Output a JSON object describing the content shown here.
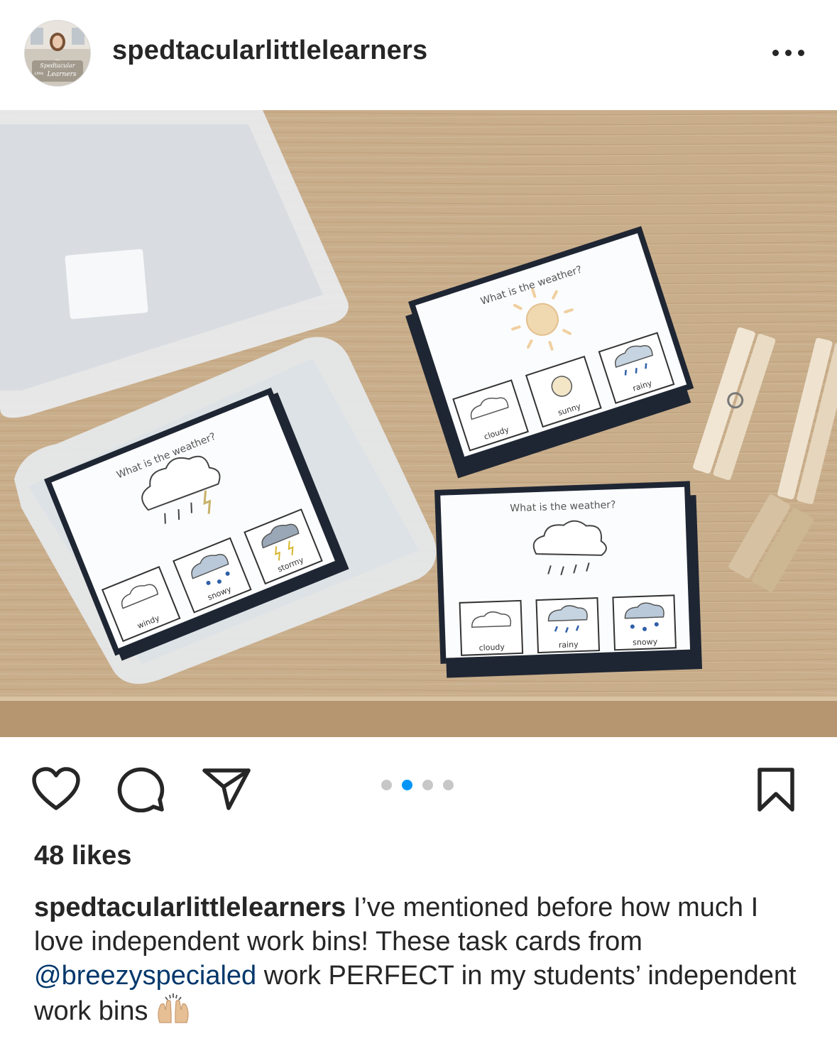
{
  "post": {
    "username": "spedtacularlittlelearners",
    "avatar_text": [
      "Spedtacular",
      "Little",
      "Learners"
    ],
    "more_icon": "more-horizontal-icon"
  },
  "photo": {
    "cards": [
      {
        "question": "What is the weather?",
        "options": [
          "windy",
          "snowy",
          "stormy"
        ]
      },
      {
        "question": "What is the weather?",
        "options": [
          "cloudy",
          "sunny",
          "rainy"
        ]
      },
      {
        "question": "What is the weather?",
        "options": [
          "cloudy",
          "rainy",
          "snowy"
        ]
      }
    ]
  },
  "actions": {
    "icons": [
      "heart-icon",
      "comment-icon",
      "share-icon",
      "bookmark-icon"
    ],
    "carousel": {
      "total": 4,
      "active_index": 1
    }
  },
  "likes": "48 likes",
  "caption": {
    "username": "spedtacularlittlelearners",
    "text_before": " I’ve mentioned before how much I love independent work bins! These task cards from ",
    "mention": "@breezyspecialed",
    "text_after": " work PERFECT in my students’ independent work bins ",
    "emoji": "raising-hands-emoji"
  },
  "colors": {
    "text": "#262626",
    "link": "#00376b",
    "accent": "#0095f6",
    "wood": "#c8ad8a"
  }
}
